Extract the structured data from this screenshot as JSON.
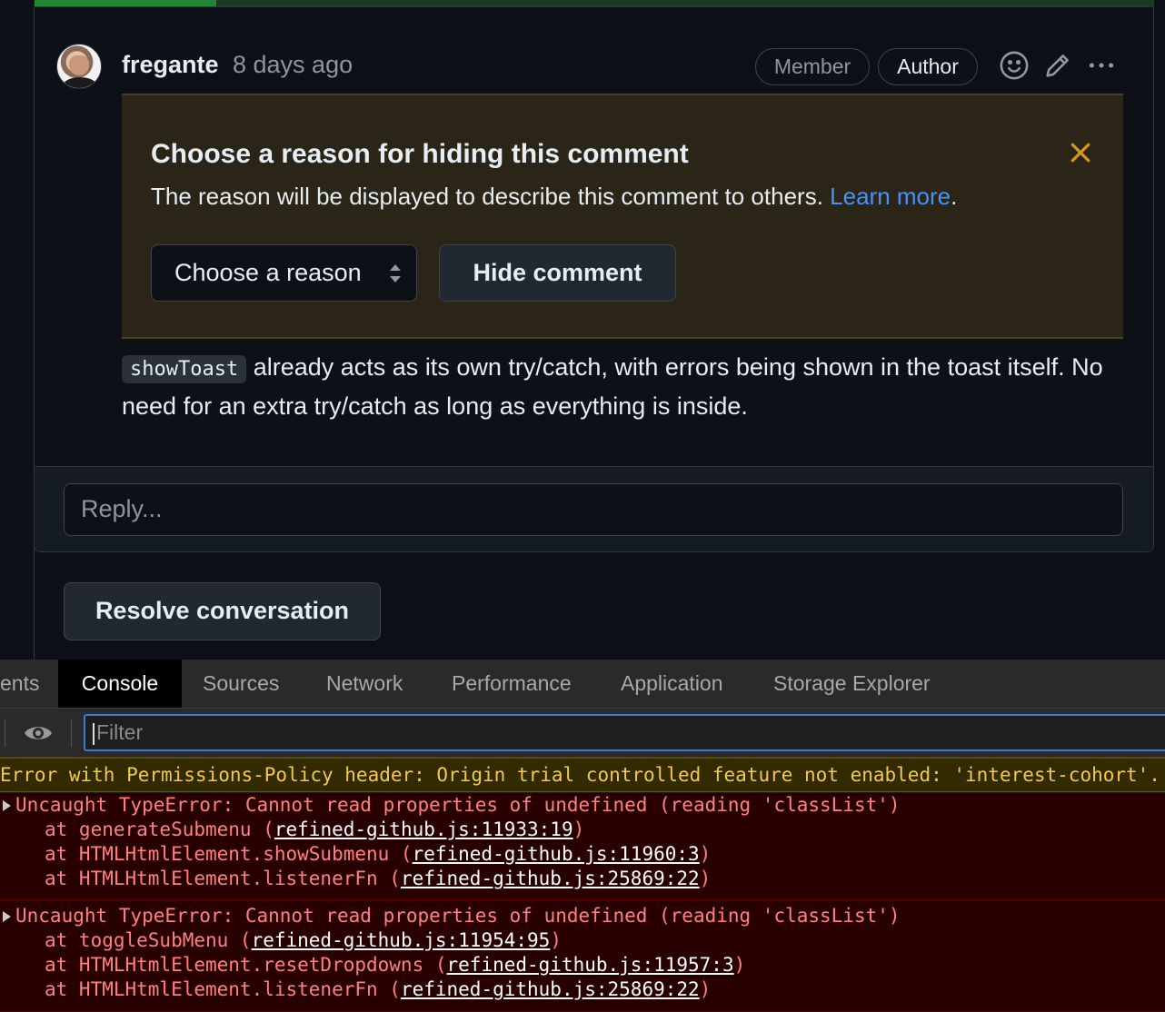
{
  "comment": {
    "author": "fregante",
    "time": "8 days ago",
    "badges": {
      "member": "Member",
      "author": "Author"
    },
    "icons": {
      "reaction": "smiley-icon",
      "edit": "pencil-icon",
      "more": "kebab-horizontal-icon",
      "close": "x-icon"
    },
    "hide_panel": {
      "title": "Choose a reason for hiding this comment",
      "description": "The reason will be displayed to describe this comment to others.",
      "learn_more": "Learn more",
      "period": ".",
      "select_value": "Choose a reason",
      "hide_button": "Hide comment"
    },
    "body_code": "showToast",
    "body_text": " already acts as its own try/catch, with errors being shown in the toast itself. No need for an extra try/catch as long as everything is inside."
  },
  "reply": {
    "placeholder": "Reply..."
  },
  "resolve_button": "Resolve conversation",
  "devtools": {
    "tabs": [
      "ents",
      "Console",
      "Sources",
      "Network",
      "Performance",
      "Application",
      "Storage Explorer"
    ],
    "active_tab": "Console",
    "filter_placeholder": "Filter",
    "warning": "Error with Permissions-Policy header: Origin trial controlled feature not enabled: 'interest-cohort'.",
    "errors": [
      {
        "message": "Uncaught TypeError: Cannot read properties of undefined (reading 'classList')",
        "stack": [
          {
            "at": "at generateSubmenu (",
            "src": "refined-github.js:11933:19",
            "end": ")"
          },
          {
            "at": "at HTMLHtmlElement.showSubmenu (",
            "src": "refined-github.js:11960:3",
            "end": ")"
          },
          {
            "at": "at HTMLHtmlElement.listenerFn (",
            "src": "refined-github.js:25869:22",
            "end": ")"
          }
        ]
      },
      {
        "message": "Uncaught TypeError: Cannot read properties of undefined (reading 'classList')",
        "stack": [
          {
            "at": "at toggleSubMenu (",
            "src": "refined-github.js:11954:95",
            "end": ")"
          },
          {
            "at": "at HTMLHtmlElement.resetDropdowns (",
            "src": "refined-github.js:11957:3",
            "end": ")"
          },
          {
            "at": "at HTMLHtmlElement.listenerFn (",
            "src": "refined-github.js:25869:22",
            "end": ")"
          }
        ]
      }
    ]
  },
  "colors": {
    "accent_link": "#4493f8",
    "panel_bg": "#2a2517",
    "error_text": "#ff8080",
    "warning_text": "#f2c94c"
  }
}
